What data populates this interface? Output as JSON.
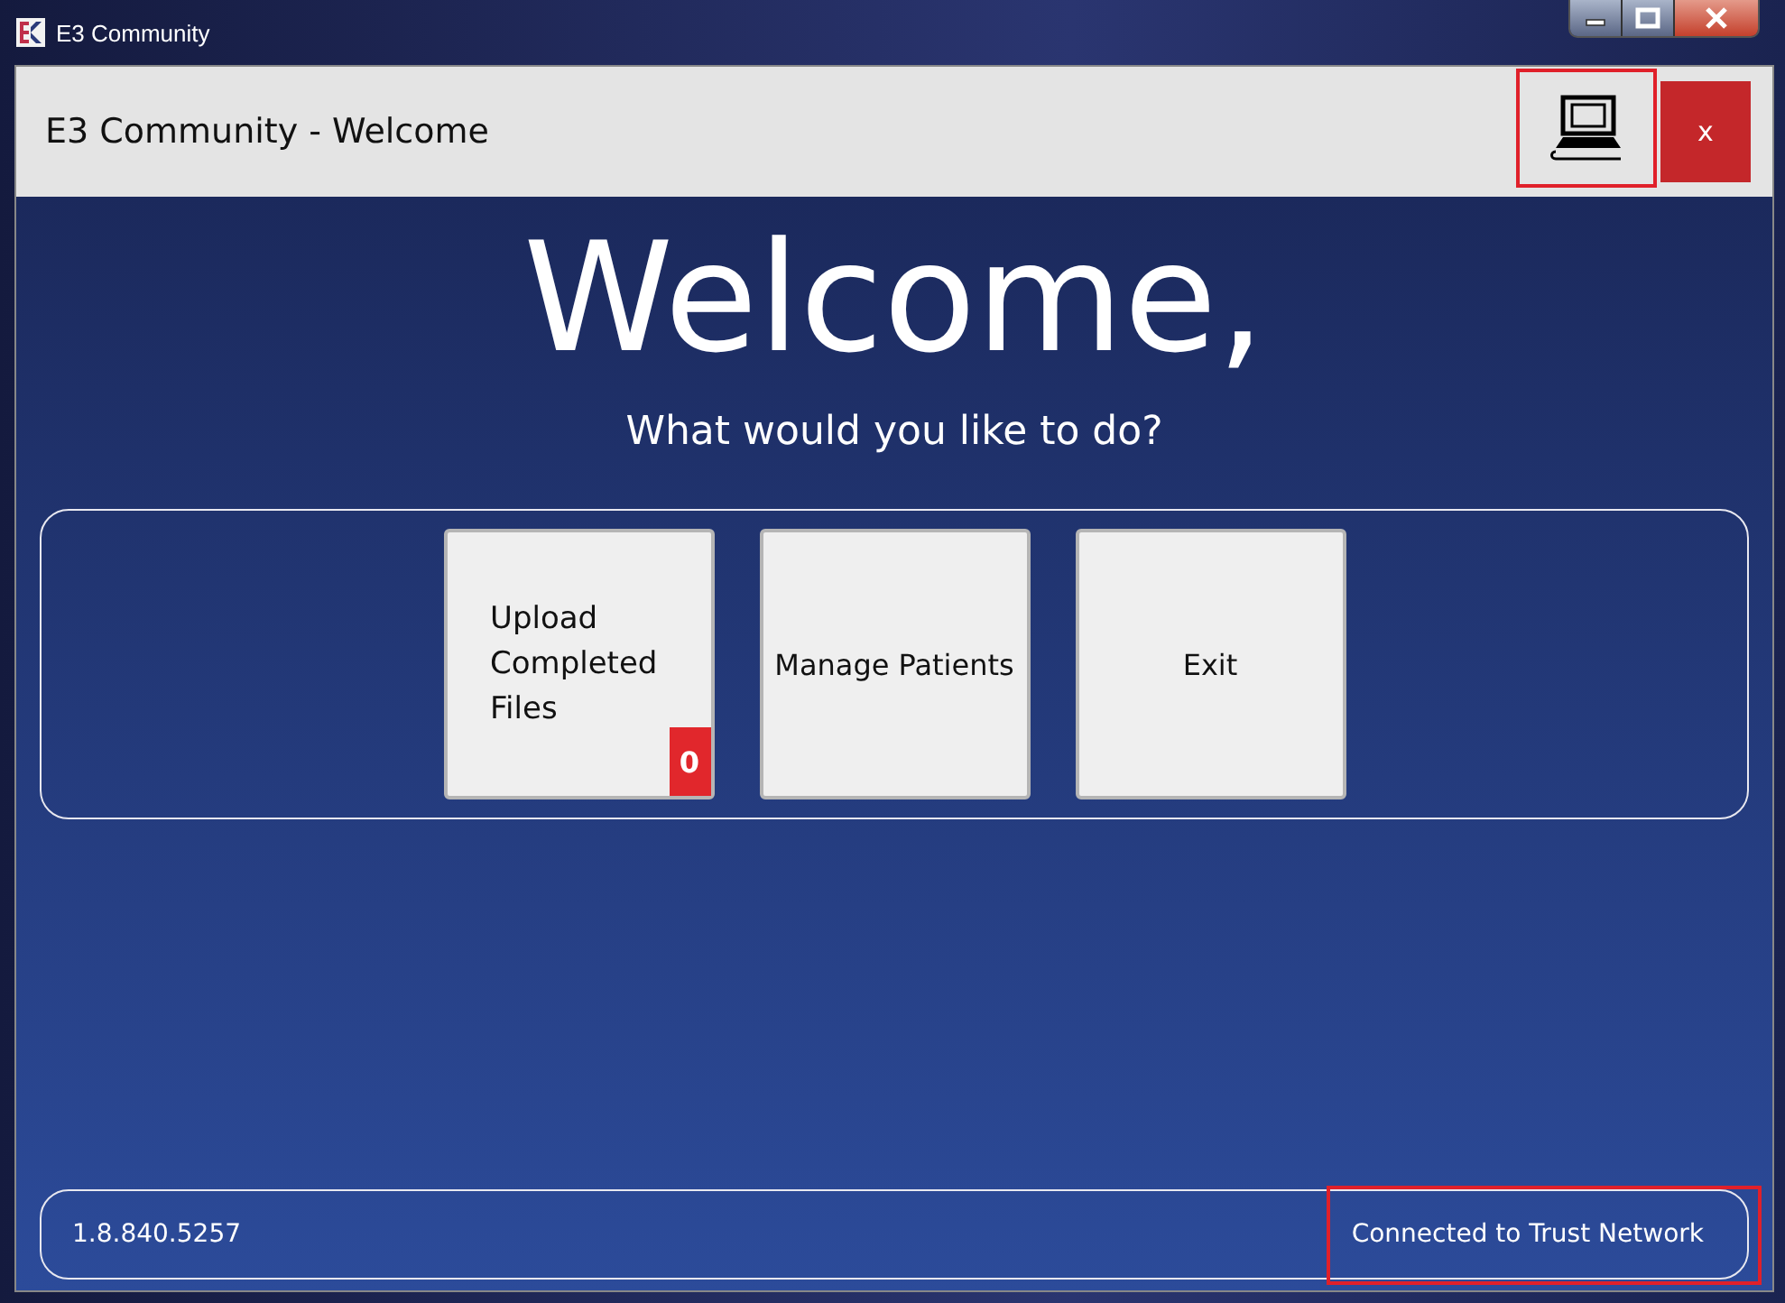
{
  "window": {
    "title": "E3 Community"
  },
  "header": {
    "title": "E3 Community - Welcome",
    "computer_highlighted": true,
    "close_label": "x"
  },
  "heading": "Welcome,",
  "subtitle": "What would you like to do?",
  "actions": [
    {
      "label": "Upload Completed Files",
      "badge": "0"
    },
    {
      "label": "Manage Patients"
    },
    {
      "label": "Exit"
    }
  ],
  "status_bar": {
    "version": "1.8.840.5257",
    "status": "Connected to Trust Network",
    "status_highlighted": true
  }
}
